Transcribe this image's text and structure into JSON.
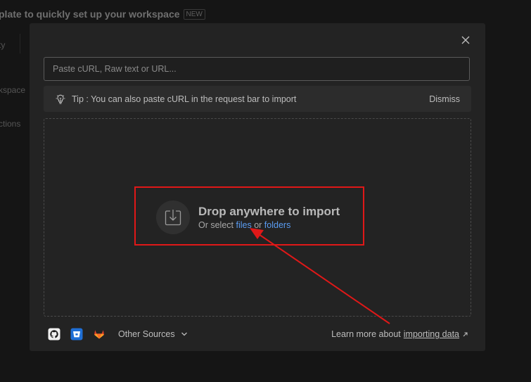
{
  "background": {
    "title": "plate to quickly set up your workspace",
    "badge": "NEW",
    "items": [
      "ty",
      "kspace",
      "ctions"
    ]
  },
  "modal": {
    "input_placeholder": "Paste cURL, Raw text or URL...",
    "tip_text": "Tip : You can also paste cURL in the request bar to import",
    "dismiss_label": "Dismiss",
    "drop_title": "Drop anywhere to import",
    "drop_prefix": "Or select ",
    "files_link": "files",
    "or_text": " or ",
    "folders_link": "folders",
    "other_sources_label": "Other Sources",
    "learn_prefix": "Learn more about ",
    "learn_link": "importing data",
    "sources": [
      {
        "name": "github-icon"
      },
      {
        "name": "bitbucket-icon"
      },
      {
        "name": "gitlab-icon"
      }
    ]
  },
  "colors": {
    "accent_link": "#5a9cf2",
    "annotation": "#e01818",
    "modal_bg": "#232323"
  }
}
